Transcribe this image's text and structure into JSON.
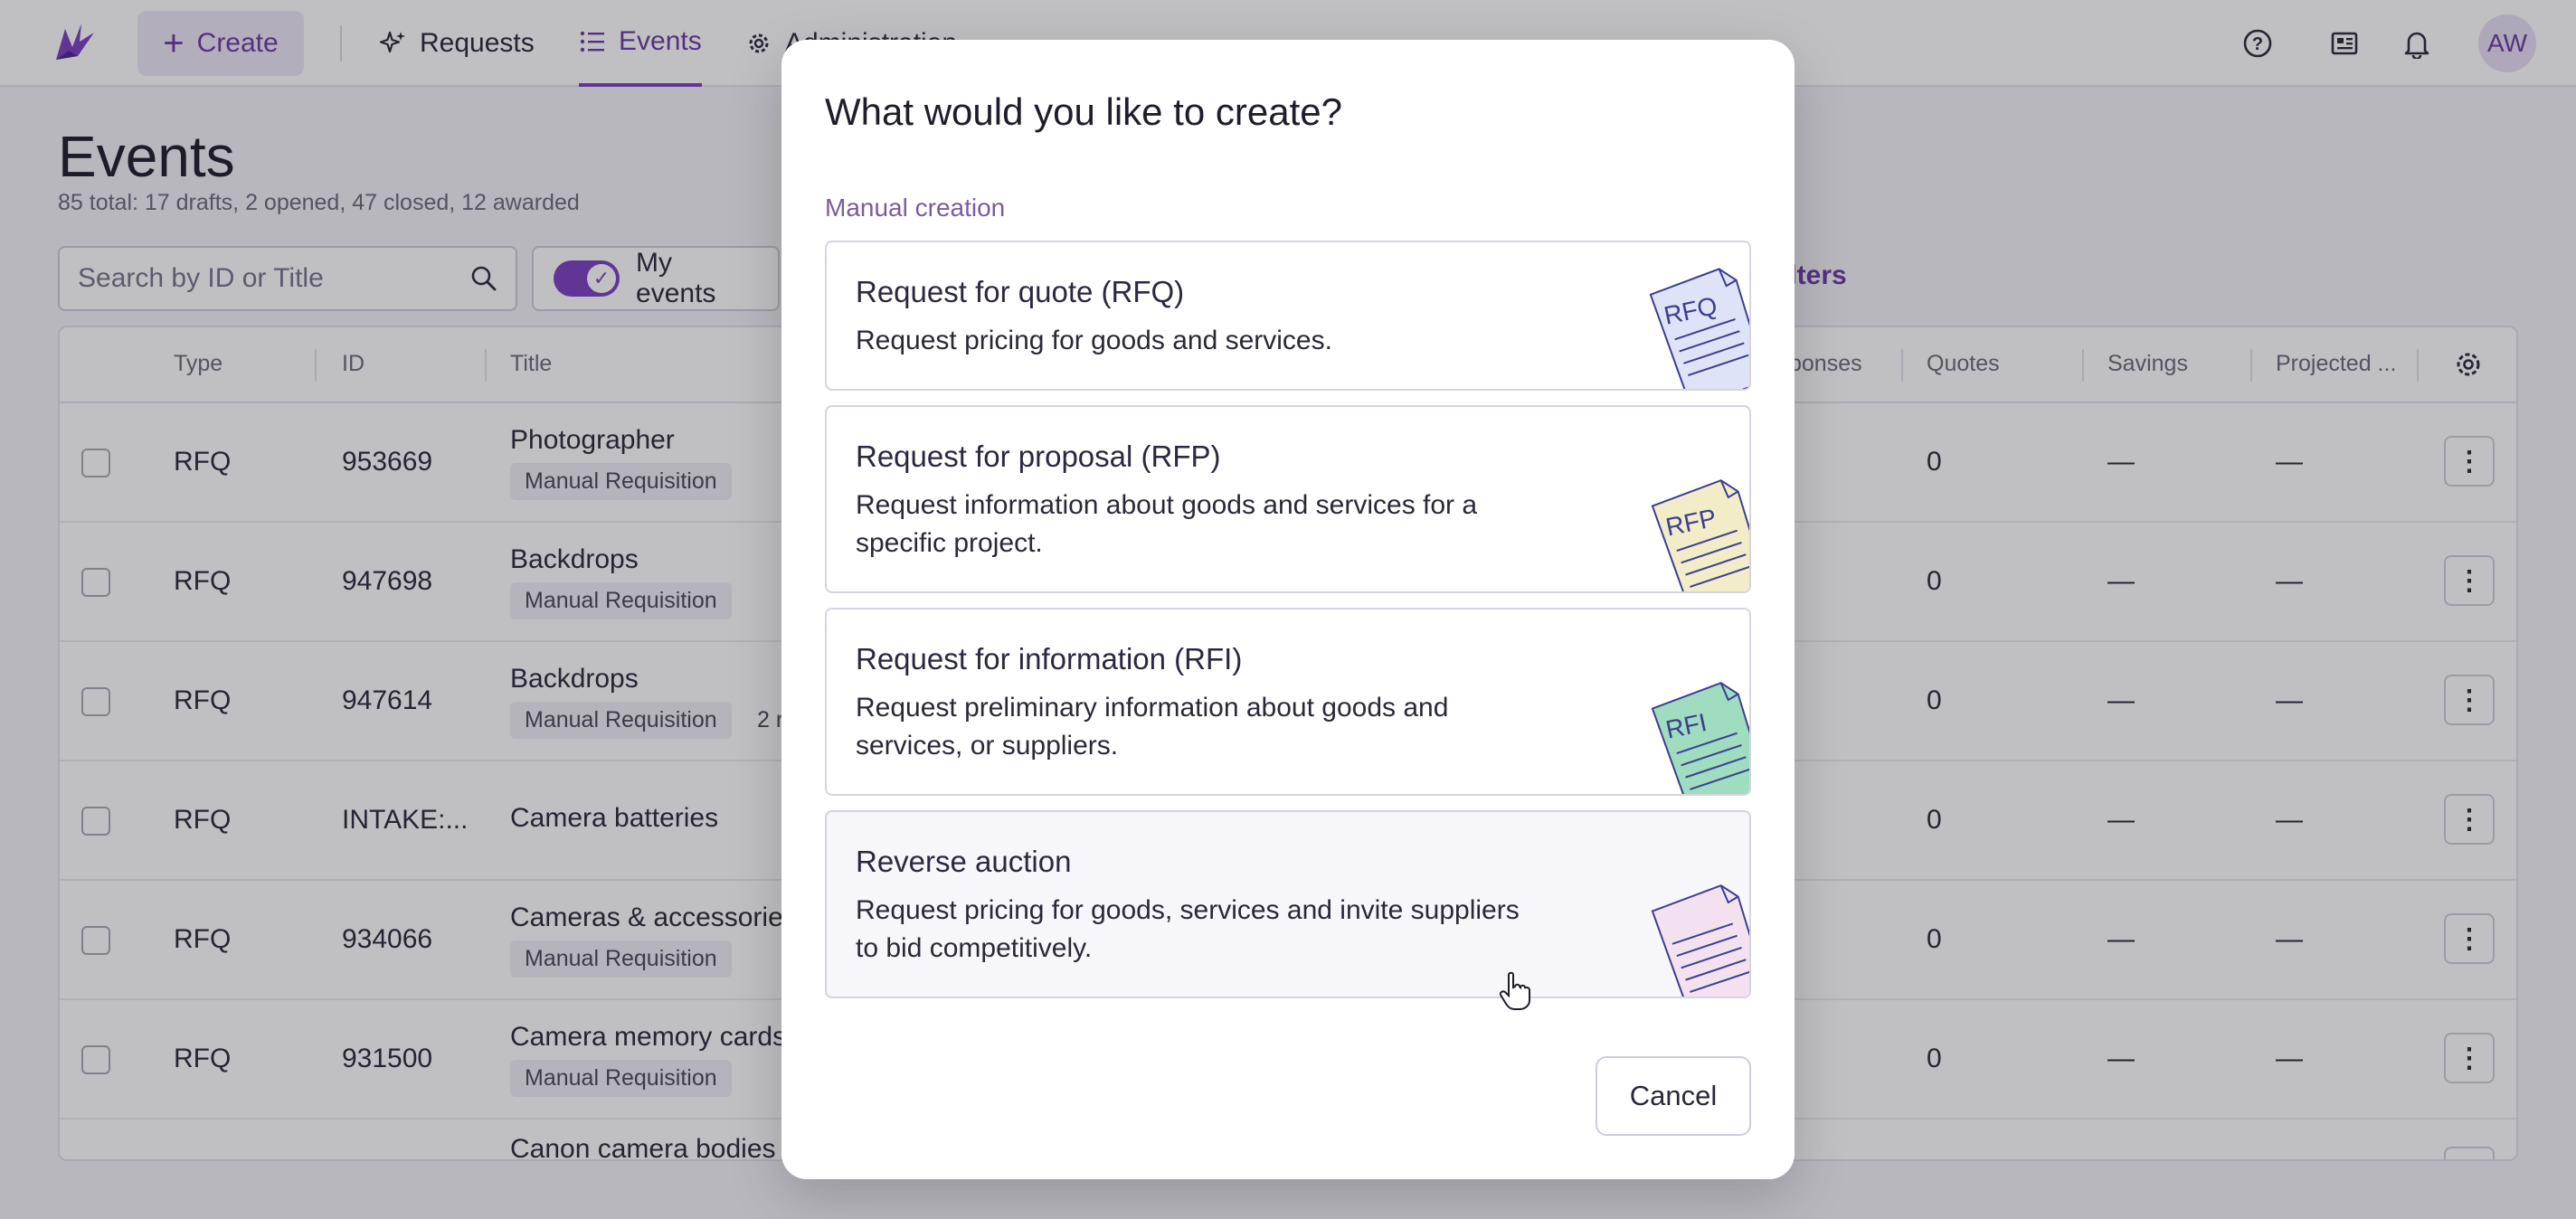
{
  "nav": {
    "create_label": "Create",
    "items": [
      {
        "label": "Requests"
      },
      {
        "label": "Events",
        "active": true
      },
      {
        "label": "Administration"
      }
    ],
    "avatar_initials": "AW",
    "accent_color": "#7a3fbf"
  },
  "page": {
    "title": "Events",
    "subtitle": "85 total: 17 drafts, 2 opened, 47 closed, 12 awarded",
    "search_placeholder": "Search by ID or Title",
    "my_events_label": "My events",
    "my_events_on": true,
    "filters_label": "r filters"
  },
  "table": {
    "columns": [
      "Type",
      "ID",
      "Title",
      "ponses",
      "Quotes",
      "Savings",
      "Projected ..."
    ],
    "rows": [
      {
        "type": "RFQ",
        "id": "953669",
        "title": "Photographer",
        "tag": "Manual Requisition",
        "extra": "",
        "quotes": "0",
        "savings": "—",
        "projected": "—"
      },
      {
        "type": "RFQ",
        "id": "947698",
        "title": "Backdrops",
        "tag": "Manual Requisition",
        "extra": "",
        "quotes": "0",
        "savings": "—",
        "projected": "—"
      },
      {
        "type": "RFQ",
        "id": "947614",
        "title": "Backdrops",
        "tag": "Manual Requisition",
        "extra": "2 r",
        "quotes": "0",
        "savings": "—",
        "projected": "—"
      },
      {
        "type": "RFQ",
        "id": "INTAKE:...",
        "title": "Camera batteries",
        "tag": "",
        "extra": "",
        "quotes": "0",
        "savings": "—",
        "projected": "—"
      },
      {
        "type": "RFQ",
        "id": "934066",
        "title": "Cameras & accessories",
        "tag": "Manual Requisition",
        "extra": "",
        "quotes": "0",
        "savings": "—",
        "projected": "—"
      },
      {
        "type": "RFQ",
        "id": "931500",
        "title": "Camera memory cards",
        "tag": "Manual Requisition",
        "extra": "",
        "quotes": "0",
        "savings": "—",
        "projected": "—"
      },
      {
        "type": "",
        "id": "",
        "title": "Canon camera bodies",
        "tag": "",
        "extra": "",
        "quotes": "",
        "savings": "",
        "projected": ""
      }
    ]
  },
  "modal": {
    "title": "What would you like to create?",
    "section_label": "Manual creation",
    "options": [
      {
        "title": "Request for quote (RFQ)",
        "description": "Request pricing for goods and services.",
        "icon": "rfq-document-icon",
        "icon_text": "RFQ",
        "icon_color": "#dfe3f7"
      },
      {
        "title": "Request for proposal (RFP)",
        "description": "Request information about goods and services for a specific project.",
        "icon": "rfp-document-icon",
        "icon_text": "RFP",
        "icon_color": "#f3ecc9"
      },
      {
        "title": "Request for information (RFI)",
        "description": "Request preliminary information about goods and services, or suppliers.",
        "icon": "rfi-document-icon",
        "icon_text": "RFI",
        "icon_color": "#9fdcc0"
      },
      {
        "title": "Reverse auction",
        "description": "Request pricing for goods, services and invite suppliers to bid competitively.",
        "icon": "auction-document-icon",
        "icon_text": "",
        "icon_color": "#f4e1f0"
      }
    ],
    "cancel_label": "Cancel"
  }
}
